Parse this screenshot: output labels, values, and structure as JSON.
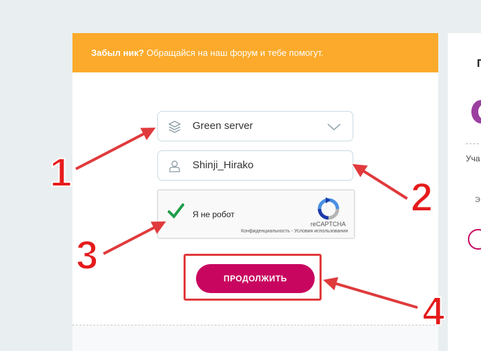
{
  "banner": {
    "bold_text": "Забыл ник?",
    "text": " Обращайся на наш форум и тебе помогут."
  },
  "server_select": {
    "icon": "layers-icon",
    "value": "Green server",
    "chevron": "chevron-down-icon"
  },
  "nickname_field": {
    "icon": "user-icon",
    "value": "Shinji_Hirako"
  },
  "captcha": {
    "label": "Я не робот",
    "brand": "reCAPTCHA",
    "links": "Конфиденциальность - Условия использования",
    "checked": true
  },
  "continue_button": {
    "label": "ПРОДОЛЖИТЬ"
  },
  "side_panel": {
    "heading": "П",
    "label_1": "Уча",
    "label_2": "Э"
  },
  "annotations": {
    "n1": "1",
    "n2": "2",
    "n3": "3",
    "n4": "4"
  },
  "colors": {
    "banner": "#fbaa2b",
    "button": "#c8065f",
    "annotation": "#e03a3c"
  }
}
